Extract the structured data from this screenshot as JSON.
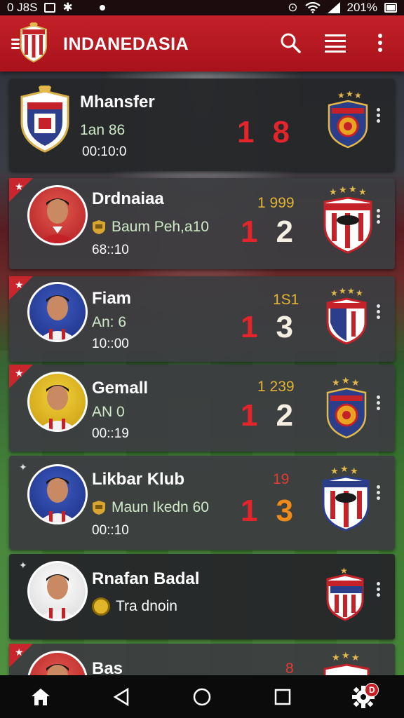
{
  "statusbar": {
    "left_text": "0 J8S",
    "battery_text": "201%"
  },
  "appbar": {
    "title": "INDANEDASIA",
    "icons": [
      "menu-icon",
      "search-icon",
      "list-icon",
      "more-vert-icon"
    ]
  },
  "matches": [
    {
      "name": "Mhansfer",
      "sub": "1an 86",
      "time": "00:10:0",
      "odds": "",
      "score_home": "1",
      "score_away": "8",
      "away_color": "red",
      "has_flag": false
    },
    {
      "name": "Drdnaiaa",
      "sub": "Baum Peh,a10",
      "time": "68::10",
      "odds": "1 999",
      "score_home": "1",
      "score_away": "2",
      "away_color": "white",
      "has_flag": true
    },
    {
      "name": "Fiam",
      "sub": "An: 6",
      "time": "10::00",
      "odds": "1S1",
      "score_home": "1",
      "score_away": "3",
      "away_color": "white",
      "has_flag": true
    },
    {
      "name": "Gemall",
      "sub": "AN 0",
      "time": "00::19",
      "odds": "1 239",
      "score_home": "1",
      "score_away": "2",
      "away_color": "white",
      "has_flag": true
    },
    {
      "name": "Likbar Klub",
      "sub": "Maun Ikedn 60",
      "time": "00::10",
      "odds": "19",
      "score_home": "1",
      "score_away": "3",
      "away_color": "orange",
      "has_flag": false
    },
    {
      "name": "Rnafan Badal",
      "sub": "Tra dnoin",
      "time": "",
      "odds": "",
      "score_home": "",
      "score_away": "",
      "away_color": "white",
      "has_flag": false
    },
    {
      "name": "Bas",
      "sub": "",
      "time": "",
      "odds": "8",
      "score_home": "",
      "score_away": "",
      "away_color": "white",
      "has_flag": true
    }
  ],
  "navbar": {
    "items": [
      "home-icon",
      "back-icon",
      "circle-home-icon",
      "recents-icon",
      "settings-icon"
    ],
    "settings_badge": "D"
  },
  "colors": {
    "appbar": "#b71620",
    "accent_red": "#e3242b",
    "odds_gold": "#e0b533",
    "card": "#3c3d40"
  }
}
